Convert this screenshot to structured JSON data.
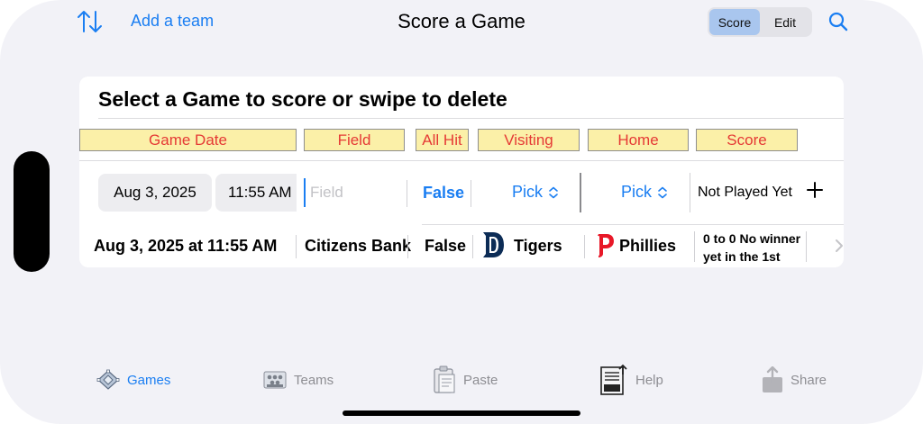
{
  "nav": {
    "add_team_label": "Add a team",
    "title": "Score a Game",
    "segments": [
      "Score",
      "Edit"
    ],
    "selected_segment": "Score"
  },
  "card": {
    "title": "Select a Game to score or swipe to delete",
    "headers": [
      "Game Date",
      "Field",
      "All Hit",
      "Visiting",
      "Home",
      "Score"
    ],
    "new_game": {
      "date": "Aug 3, 2025",
      "time": "11:55 AM",
      "field_placeholder": "Field",
      "all_hit": "False",
      "visiting": "Pick",
      "home": "Pick",
      "score": "Not Played Yet"
    },
    "games": [
      {
        "date_time": "Aug 3, 2025 at 11:55 AM",
        "field": "Citizens Bank",
        "all_hit": "False",
        "visiting": "Tigers",
        "home": "Phillies",
        "result_line1": "0 to 0 No winner",
        "result_line2": "yet in the 1st"
      }
    ]
  },
  "tabs": [
    {
      "label": "Games",
      "icon": "baseball-diamond-icon",
      "active": true
    },
    {
      "label": "Teams",
      "icon": "team-photo-icon",
      "active": false
    },
    {
      "label": "Paste",
      "icon": "clipboard-icon",
      "active": false
    },
    {
      "label": "Help",
      "icon": "document-help-icon",
      "active": false
    },
    {
      "label": "Share",
      "icon": "share-icon",
      "active": false
    }
  ],
  "colors": {
    "accent": "#1a7ef2",
    "header_fill": "#fbf0a8",
    "header_text": "#e53935",
    "tigers_navy": "#0c2c56",
    "phillies_red": "#e81828"
  }
}
